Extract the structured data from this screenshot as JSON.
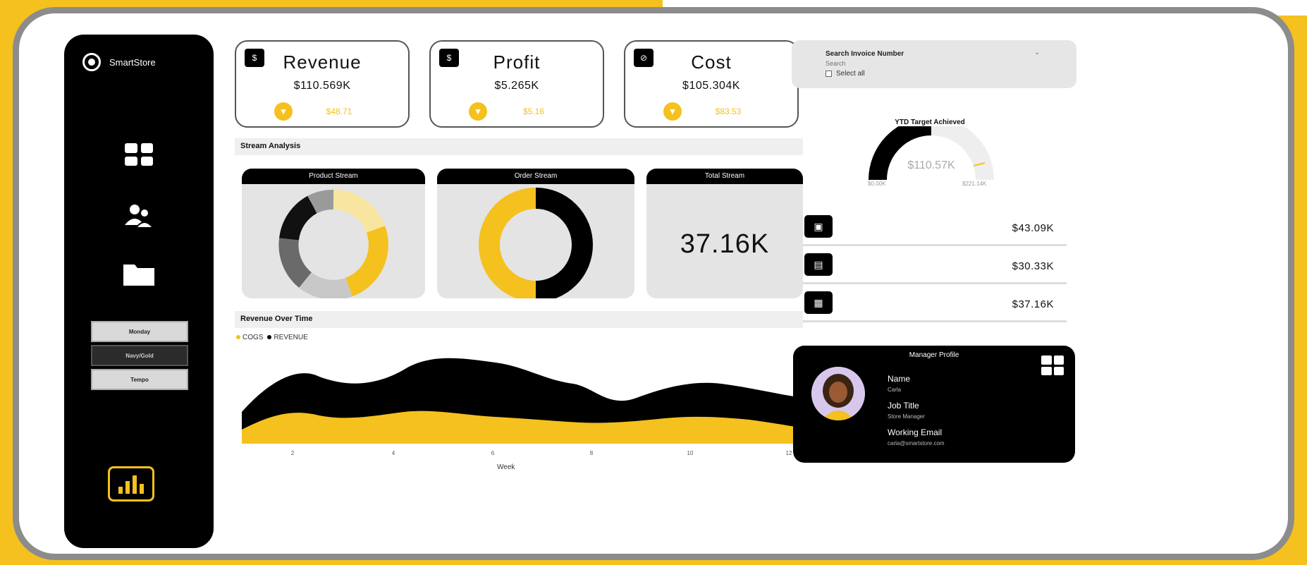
{
  "app": {
    "name": "SmartStore"
  },
  "sidebar": {
    "buttons": [
      "Monday",
      "Navy/Gold",
      "Tempo"
    ]
  },
  "kpis": [
    {
      "title": "Revenue",
      "value": "$110.569K",
      "delta": "$48.71",
      "icon": "dollar-icon"
    },
    {
      "title": "Profit",
      "value": "$5.265K",
      "delta": "$5.16",
      "icon": "dollar-icon"
    },
    {
      "title": "Cost",
      "value": "$105.304K",
      "delta": "$83.53",
      "icon": "cost-icon"
    }
  ],
  "stream_analysis": {
    "title": "Stream Analysis",
    "product_stream": "Product Stream",
    "order_stream": "Order Stream",
    "total_stream": "Total Stream",
    "total_value": "37.16K"
  },
  "revenue_over_time": {
    "title": "Revenue Over Time",
    "legend": [
      "COGS",
      "REVENUE"
    ],
    "x_label": "Week",
    "x_ticks": [
      "2",
      "4",
      "6",
      "8",
      "10",
      "12"
    ]
  },
  "search": {
    "title": "Search Invoice Number",
    "placeholder": "Search",
    "select_all": "Select all"
  },
  "gauge": {
    "title": "YTD Target Achieved",
    "value": "$110.57K",
    "min": "$0.00K",
    "max": "$221.14K",
    "fraction": 0.5
  },
  "stats": [
    {
      "icon": "cash-icon",
      "value": "$43.09K"
    },
    {
      "icon": "card-icon",
      "value": "$30.33K"
    },
    {
      "icon": "bills-icon",
      "value": "$37.16K"
    }
  ],
  "manager": {
    "title": "Manager Profile",
    "name_label": "Name",
    "name": "Carla",
    "job_label": "Job Title",
    "job": "Store Manager",
    "email_label": "Working Email",
    "email": "carla@smartstore.com"
  },
  "colors": {
    "accent": "#f4c11e",
    "dark": "#000000",
    "gray": "#e4e4e4"
  }
}
